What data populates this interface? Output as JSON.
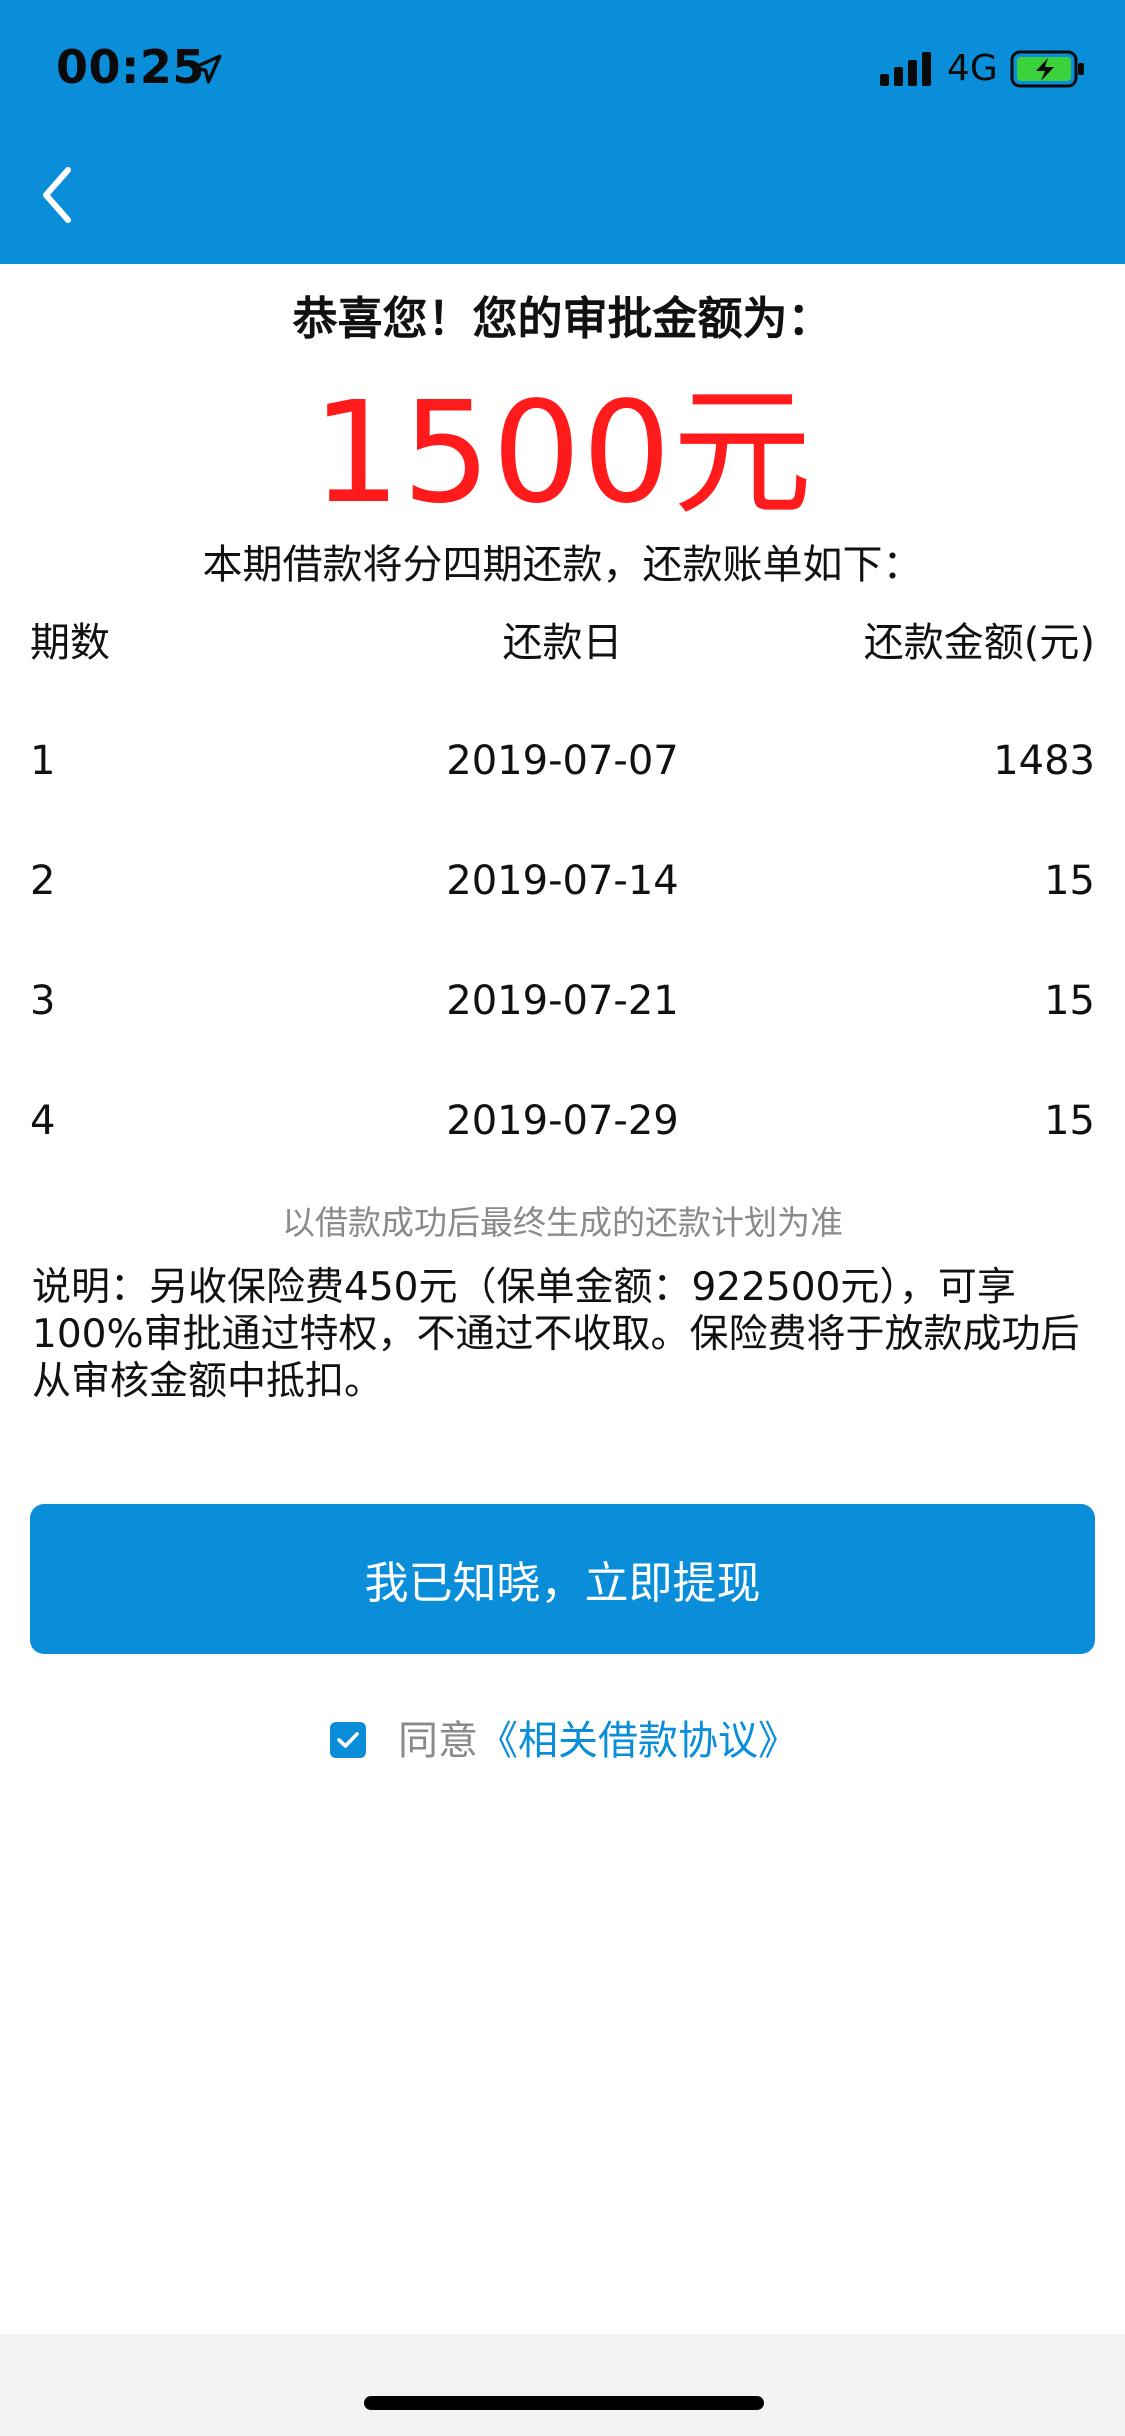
{
  "status_bar": {
    "time": "00:25",
    "network": "4G"
  },
  "nav": {
    "back_icon": "back-chevron-icon"
  },
  "approval": {
    "title": "恭喜您！您的审批金额为：",
    "amount": "1500元"
  },
  "plan": {
    "intro": "本期借款将分四期还款，还款账单如下：",
    "columns": [
      "期数",
      "还款日",
      "还款金额(元)"
    ],
    "rows": [
      {
        "period": "1",
        "date": "2019-07-07",
        "amount": "1483"
      },
      {
        "period": "2",
        "date": "2019-07-14",
        "amount": "15"
      },
      {
        "period": "3",
        "date": "2019-07-21",
        "amount": "15"
      },
      {
        "period": "4",
        "date": "2019-07-29",
        "amount": "15"
      }
    ],
    "note": "以借款成功后最终生成的还款计划为准"
  },
  "description": "说明：另收保险费450元（保单金额：922500元），可享100%审批通过特权，不通过不收取。保险费将于放款成功后从审核金额中抵扣。",
  "primary_button": {
    "label": "我已知晓，立即提现"
  },
  "agreement": {
    "agree_label": "同意",
    "link_label": "《相关借款协议》",
    "checked": true
  },
  "colors": {
    "brand_blue": "#0A8ED9",
    "amount_red": "#FF1B1B",
    "muted_gray": "#8A8A8A"
  }
}
